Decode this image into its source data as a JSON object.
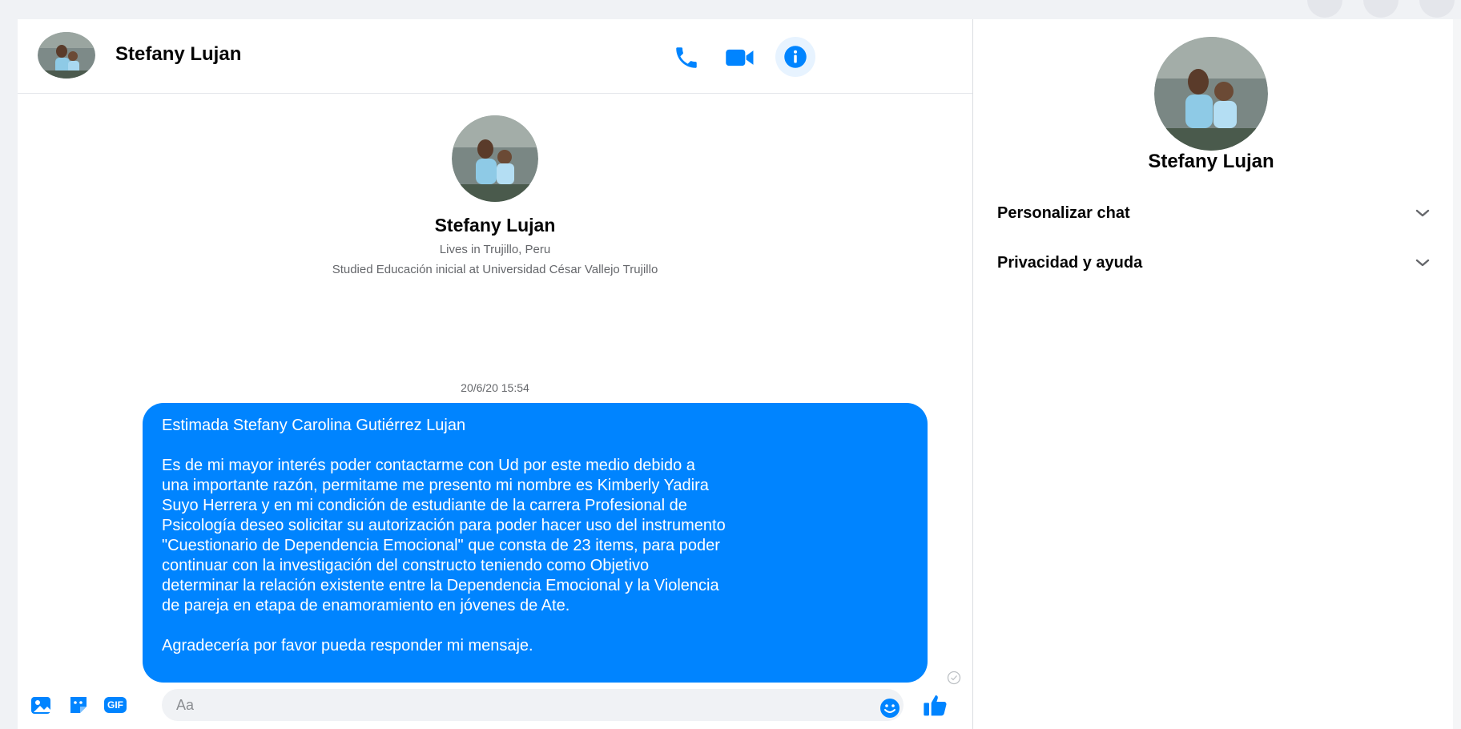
{
  "contact": {
    "name": "Stefany Lujan",
    "lives_in": "Lives in Trujillo, Peru",
    "studied": "Studied Educación inicial at Universidad César Vallejo Trujillo"
  },
  "header": {
    "icons": [
      "phone-icon",
      "video-camera-icon",
      "info-icon"
    ]
  },
  "conversation": {
    "timestamp": "20/6/20 15:54",
    "message": {
      "greeting": "Estimada Stefany Carolina Gutiérrez Lujan",
      "lines": [
        "Es de mi mayor interés poder contactarme con Ud por este medio debido a",
        "una importante razón, permitame me presento mi nombre es Kimberly Yadira",
        "Suyo Herrera y en mi condición de estudiante de la carrera Profesional de",
        "Psicología deseo solicitar su autorización para poder hacer uso del instrumento",
        "\"Cuestionario de Dependencia Emocional\" que consta de 23 items, para poder",
        "continuar con la investigación del constructo teniendo como Objetivo",
        "determinar la relación existente entre la Dependencia Emocional y la Violencia",
        "de pareja en etapa de enamoramiento en jóvenes de Ate."
      ],
      "closing": "Agradecería por favor pueda responder mi mensaje."
    }
  },
  "composer": {
    "placeholder": "Aa",
    "gif_label": "GIF",
    "icons": [
      "image-icon",
      "sticker-icon",
      "gif-icon",
      "emoji-icon",
      "thumbs-up-icon"
    ]
  },
  "sidebar": {
    "items": [
      {
        "label": "Personalizar chat",
        "icon": "chevron-down-icon"
      },
      {
        "label": "Privacidad y ayuda",
        "icon": "chevron-down-icon"
      }
    ]
  },
  "colors": {
    "accent": "#0084ff",
    "background": "#f0f2f5",
    "secondary_text": "#65676b"
  }
}
